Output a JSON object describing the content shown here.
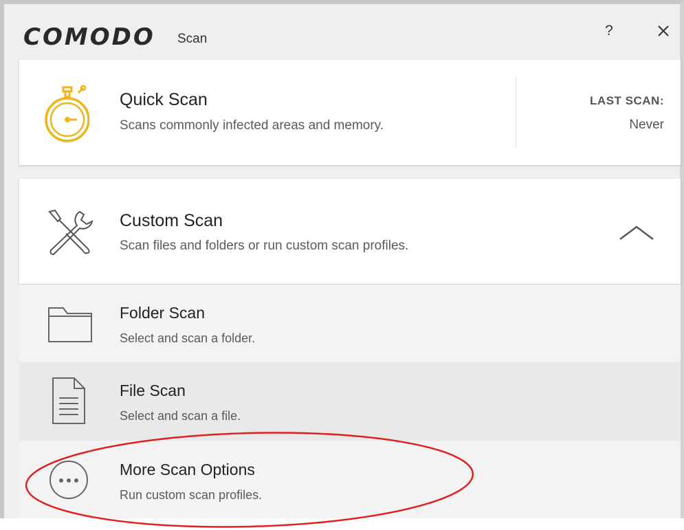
{
  "app": {
    "brand": "COMODO",
    "title": "Scan"
  },
  "titlebar": {
    "help_label": "?",
    "close_icon": "close-icon"
  },
  "quick_scan": {
    "title": "Quick Scan",
    "description": "Scans commonly infected areas and memory.",
    "icon": "stopwatch-icon",
    "last_scan_label": "LAST SCAN:",
    "last_scan_value": "Never"
  },
  "custom_scan": {
    "title": "Custom Scan",
    "description": "Scan files and folders or run custom scan profiles.",
    "icon": "tools-icon",
    "collapse_icon": "chevron-up-icon",
    "items": [
      {
        "title": "Folder Scan",
        "description": "Select and scan a folder.",
        "icon": "folder-icon"
      },
      {
        "title": "File Scan",
        "description": "Select and scan a file.",
        "icon": "file-icon"
      },
      {
        "title": "More Scan Options",
        "description": "Run custom scan profiles.",
        "icon": "more-options-icon"
      }
    ]
  },
  "colors": {
    "stopwatch": "#f0b31a",
    "annotation": "#e02020"
  }
}
